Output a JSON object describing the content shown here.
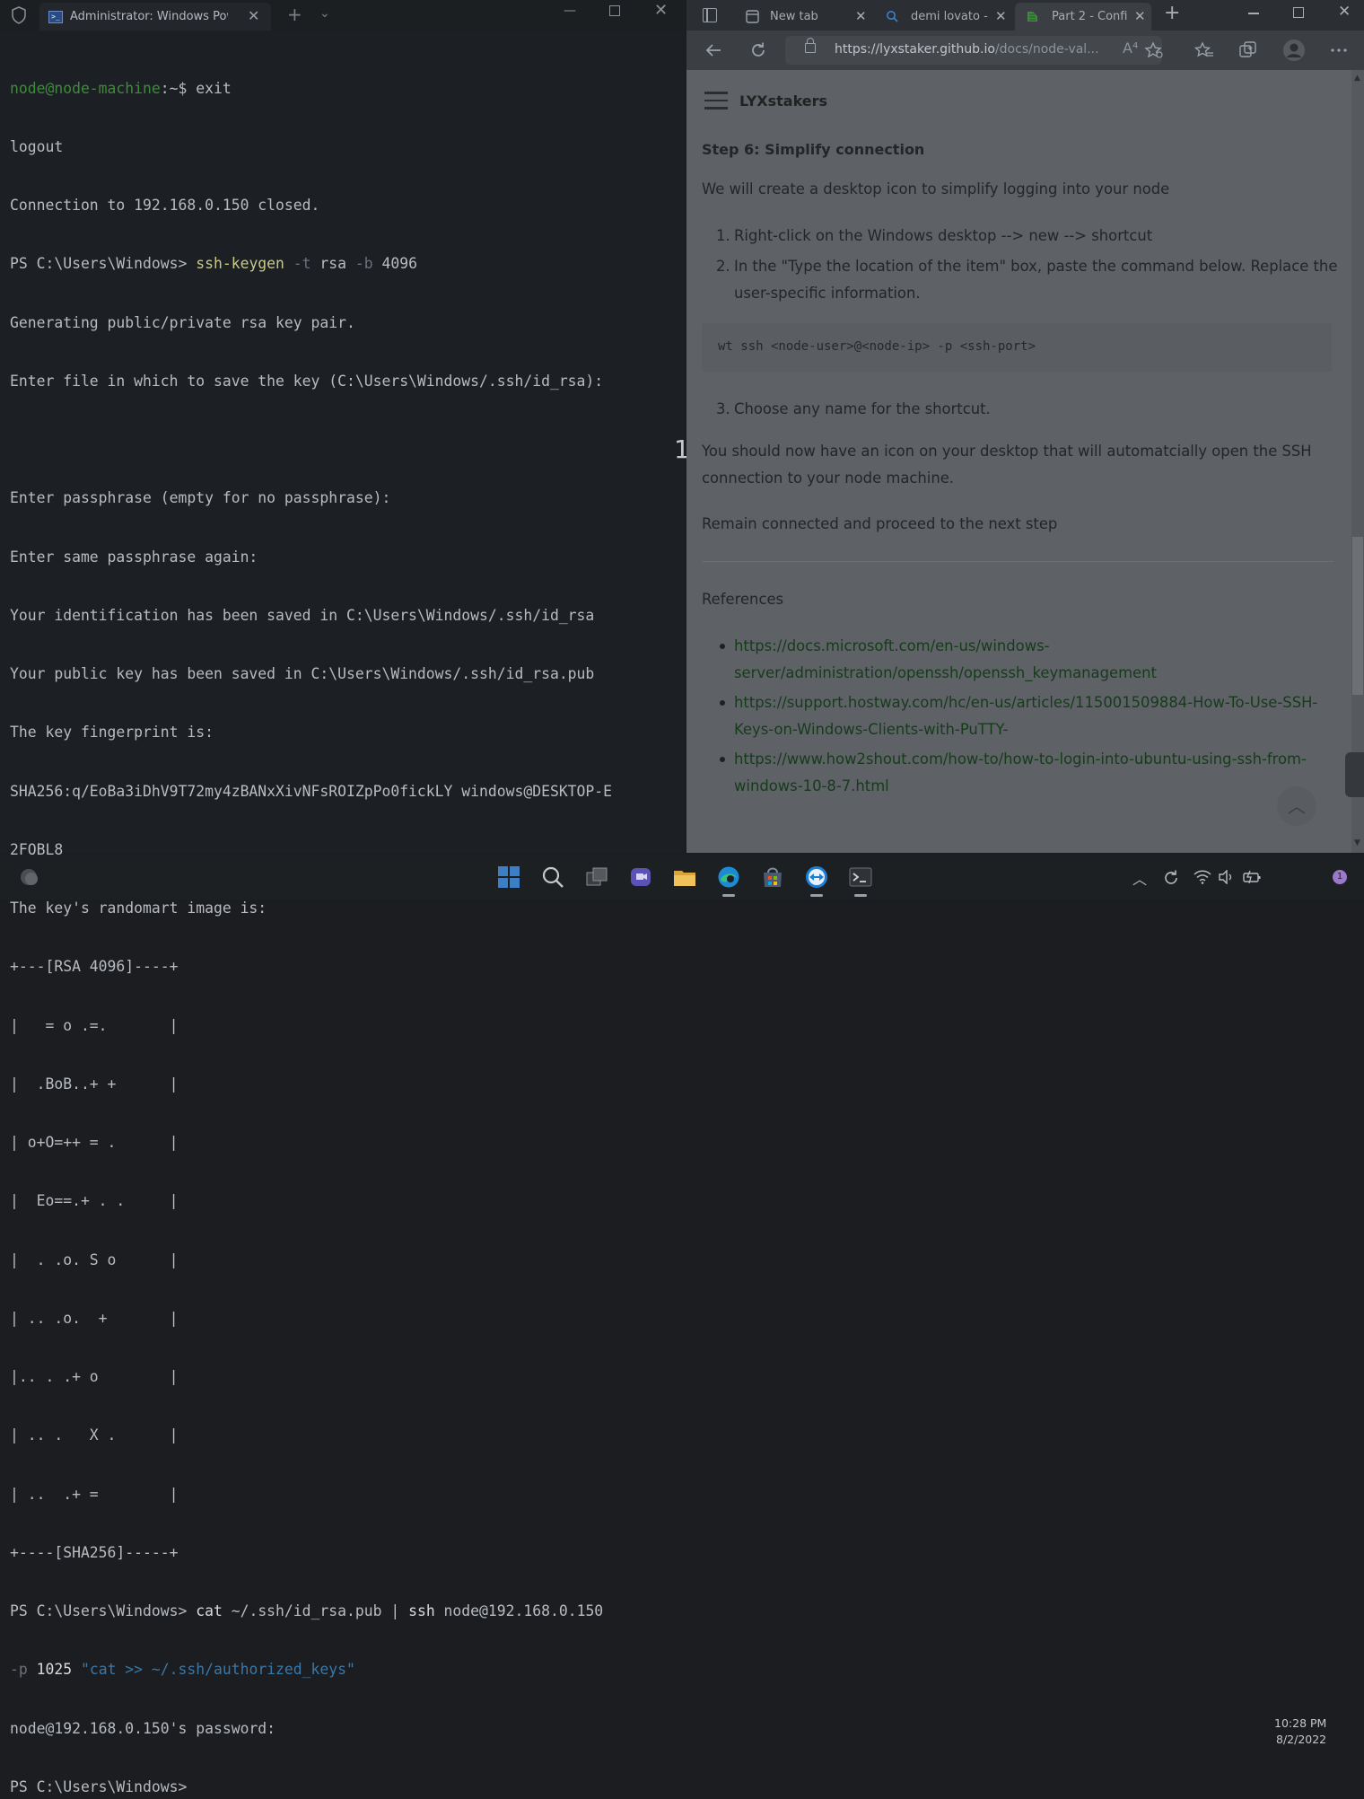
{
  "terminal": {
    "tab_title": "Administrator: Windows Powe",
    "tab_icon_glyph": ">_",
    "new_tab_glyph": "+",
    "dropdown_glyph": "⌄",
    "close_glyph": "✕",
    "minimize_glyph": "—",
    "lines": {
      "l1a": "node@node-machine",
      "l1b": ":~$ exit",
      "l2": "logout",
      "l3": "Connection to 192.168.0.150 closed.",
      "l4a": "PS C:\\Users\\Windows> ",
      "l4b": "ssh-keygen",
      "l4c": " -t ",
      "l4d": "rsa",
      "l4e": " -b ",
      "l4f": "4096",
      "l5": "Generating public/private rsa key pair.",
      "l6": "Enter file in which to save the key (C:\\Users\\Windows/.ssh/id_rsa):",
      "l7": "",
      "l8": "Enter passphrase (empty for no passphrase):",
      "l9": "Enter same passphrase again:",
      "l10": "Your identification has been saved in C:\\Users\\Windows/.ssh/id_rsa",
      "l11": "Your public key has been saved in C:\\Users\\Windows/.ssh/id_rsa.pub",
      "l12": "The key fingerprint is:",
      "l13": "SHA256:q/EoBa3iDhV9T72my4zBANxXivNFsROIZpPo0fickLY windows@DESKTOP-E",
      "l14": "2FQBL8",
      "l15": "The key's randomart image is:",
      "l16": "+---[RSA 4096]----+",
      "l17": "|   = o .=.       |",
      "l18": "|  .BoB..+ +      |",
      "l19": "| o+O=++ = .      |",
      "l20": "|  Eo==.+ . .     |",
      "l21": "|  . .o. S o      |",
      "l22": "| .. .o.  +       |",
      "l23": "|.. . .+ o        |",
      "l24": "| .. .   X .      |",
      "l25": "| ..  .+ =        |",
      "l26": "+----[SHA256]-----+",
      "l27a": "PS C:\\Users\\Windows> ",
      "l27b": "cat",
      "l27c": " ~/.ssh/id_rsa.pub | ",
      "l27d": "ssh",
      "l27e": " node@192.168.0.150",
      "l28a": "-p ",
      "l28b": "1025",
      "l28c": " \"cat >> ~/.ssh/authorized_keys\"",
      "l29": "node@192.168.0.150's password:",
      "l30": "PS C:\\Users\\Windows>"
    }
  },
  "overlay_number": "1",
  "browser": {
    "tabs": [
      {
        "title": "New tab"
      },
      {
        "title": "demi lovato -"
      },
      {
        "title": "Part 2 - Confi"
      }
    ],
    "close_glyph": "✕",
    "new_tab_glyph": "+",
    "url_host": "https://lyxstaker.github.io",
    "url_path": "/docs/node-val...",
    "read_aloud_glyph": "A⁴",
    "site_title": "LYXstakers",
    "step_title": "Step 6: Simplify connection",
    "intro": "We will create a desktop icon to simplify logging into your node",
    "steps": [
      {
        "num": "1.",
        "text": "Right-click on the Windows desktop --> new --> shortcut"
      },
      {
        "num": "2.",
        "text1": "In the \"Type the location of the item\" box, paste the command below. Replace the",
        "text2": "user-specific information."
      },
      {
        "num": "3.",
        "text": "Choose any name for the shortcut."
      }
    ],
    "code": "wt ssh <node-user>@<node-ip> -p <ssh-port>",
    "outcome1": "You should now have an icon on your desktop that will automatcially open the SSH",
    "outcome2": "connection to your node machine.",
    "remain": "Remain connected and proceed to the next step",
    "references_title": "References",
    "references": [
      {
        "line1": "https://docs.microsoft.com/en-us/windows-",
        "line2": "server/administration/openssh/openssh_keymanagement"
      },
      {
        "line1": "https://support.hostway.com/hc/en-us/articles/115001509884-How-To-Use-SSH-",
        "line2": "Keys-on-Windows-Clients-with-PuTTY-"
      },
      {
        "line1": "https://www.how2shout.com/how-to/how-to-login-into-ubuntu-using-ssh-from-",
        "line2": "windows-10-8-7.html"
      }
    ],
    "to_top_glyph": "︿"
  },
  "taskbar": {
    "time": "10:28 PM",
    "date": "8/2/2022",
    "notification_count": "1",
    "up_arrow_glyph": "︿"
  },
  "colors": {
    "terminal_bg": "#1c2024",
    "browser_page_bg": "#5e6267",
    "link": "#173a1b",
    "prompt_green": "#3f8a3c"
  }
}
